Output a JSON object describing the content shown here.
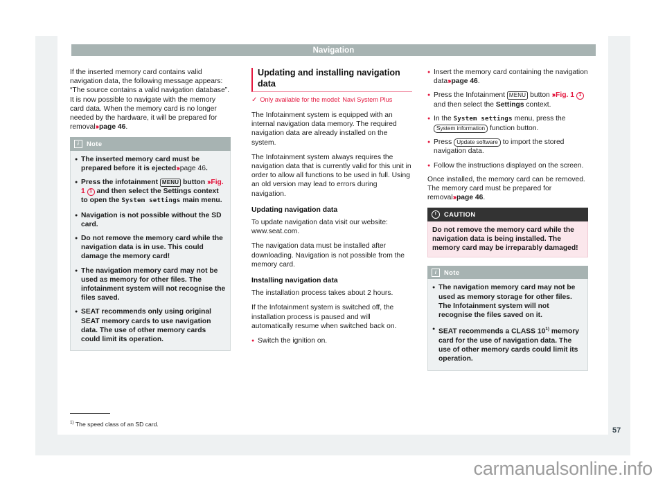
{
  "banner": {
    "chapter": "Navigation"
  },
  "left_column": {
    "intro_paragraph": {
      "text_before_xref": "If the inserted memory card contains valid navigation data, the following message appears: “The source contains a valid navigation database”. It is now possible to navigate with the memory card data. When the memory card is no longer needed by the hardware, it will be prepared for removal",
      "xref_arrows": "›››",
      "xref_target": "page 46",
      "trailing": "."
    },
    "note_box": {
      "icon": "info-icon",
      "title": "Note",
      "bullets": [
        {
          "text_a": "The inserted memory card must be prepared before it is ejected",
          "xref_arrows": "›››",
          "xref_target": "page 46",
          "text_b": "."
        },
        {
          "text_a": "Press the infotainment",
          "key": "MENU",
          "text_b": "button",
          "xref_arrows": "›››",
          "xref_fig": "Fig. 1",
          "callout": "1",
          "text_c": "and then select the Settings context to open the",
          "mono": "System settings",
          "text_d": "main menu."
        },
        {
          "text_a": "Navigation is not possible without the SD card."
        },
        {
          "text_a": "Do not remove the memory card while the navigation data is in use. This could damage the memory card!"
        },
        {
          "text_a": "The navigation memory card may not be used as memory for other files. The infotainment system will not recognise the files saved."
        },
        {
          "text_a": "SEAT recommends only using original SEAT memory cards to use navigation data. The use of other memory cards could limit its operation."
        }
      ]
    }
  },
  "middle_column": {
    "section_title": "Updating and installing navigation data",
    "applicability": {
      "tick": "✓",
      "text": "Only available for the model: Navi System Plus"
    },
    "paragraphs": [
      "The Infotainment system is equipped with an internal navigation data memory. The required navigation data are already installed on the system.",
      "The Infotainment system always requires the navigation data that is currently valid for this unit in order to allow all functions to be used in full. Using an old version may lead to errors during navigation."
    ],
    "subheading_1": "Updating navigation data",
    "paragraphs_1": [
      "To update navigation data visit our website: www.seat.com.",
      "The navigation data must be installed after downloading. Navigation is not possible from the memory card."
    ],
    "subheading_2": "Installing navigation data",
    "paragraphs_2": [
      "The installation process takes about 2 hours.",
      "If the Infotainment system is switched off, the installation process is paused and will automatically resume when switched back on."
    ],
    "bullet": "Switch the ignition on."
  },
  "right_column": {
    "bullets": [
      {
        "text_a": "Insert the memory card containing the navigation data",
        "xref_arrows": "›››",
        "xref_target": "page 46",
        "text_b": "."
      },
      {
        "text_a": "Press the Infotainment",
        "key": "MENU",
        "text_b": "button",
        "xref_arrows": "›››",
        "xref_fig": "Fig. 1",
        "callout": "1",
        "text_c": "and then select the",
        "bold_word": "Settings",
        "text_d": "context."
      },
      {
        "text_a": "In the",
        "mono": "System settings",
        "text_b": "menu, press the",
        "softkey": "System information",
        "text_c": "function button."
      },
      {
        "text_a": "Press",
        "softkey": "Update software",
        "text_b": "to import the stored navigation data."
      },
      {
        "text_a": "Follow the instructions displayed on the screen."
      }
    ],
    "closing_paragraph": {
      "text_a": "Once installed, the memory card can be removed. The memory card must be prepared for removal",
      "xref_arrows": "›››",
      "xref_target": "page 46",
      "text_b": "."
    },
    "caution_box": {
      "icon": "warning-icon",
      "title": "CAUTION",
      "body": "Do not remove the memory card while the navigation data is being installed. The memory card may be irreparably damaged!"
    },
    "note_box": {
      "icon": "info-icon",
      "title": "Note",
      "bullets": [
        {
          "text_a": "The navigation memory card may not be used as memory storage for other files. The Infotainment system will not recognise the files saved on it."
        },
        {
          "text_a": "SEAT recommends a CLASS 10",
          "footnote_marker": "1)",
          "text_b": "memory card for the use of navigation data. The use of other memory cards could limit its operation."
        }
      ]
    }
  },
  "footnote": {
    "marker": "1)",
    "text": "The speed class of an SD card."
  },
  "folio": {
    "page_number": "57"
  },
  "watermark": {
    "text": "carmanualsonline.info"
  },
  "colors": {
    "brand_red": "#e3173e",
    "banner_gray": "#a7b3b2",
    "note_bg": "#eef1f2",
    "caution_head": "#333333",
    "caution_bg": "#fbe7ec"
  }
}
